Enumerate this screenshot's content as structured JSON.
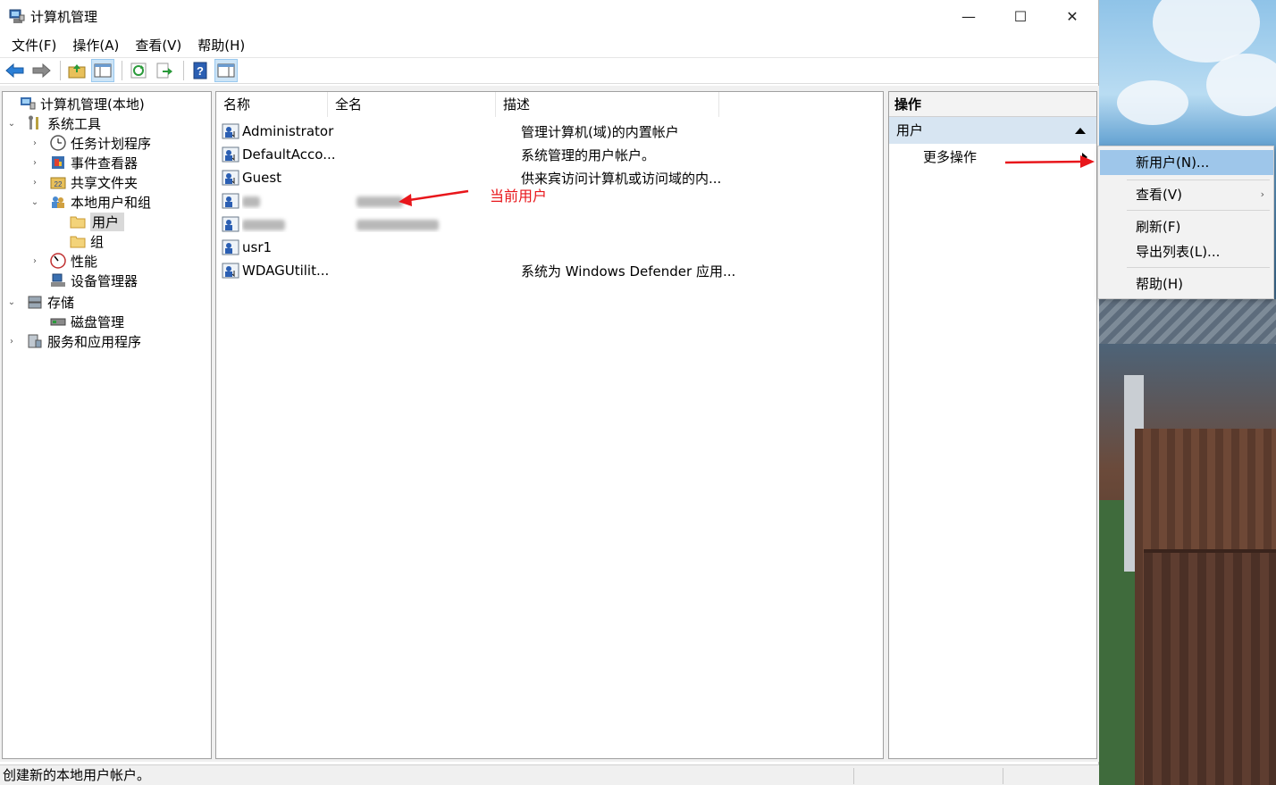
{
  "window": {
    "title": "计算机管理",
    "minimize": "—",
    "maximize": "☐",
    "close": "✕"
  },
  "menubar": {
    "items": [
      "文件(F)",
      "操作(A)",
      "查看(V)",
      "帮助(H)"
    ]
  },
  "tree": {
    "items": [
      {
        "label": "计算机管理(本地)",
        "expander": ""
      },
      {
        "label": "系统工具",
        "expander": "⌄"
      },
      {
        "label": "任务计划程序",
        "expander": "›"
      },
      {
        "label": "事件查看器",
        "expander": "›"
      },
      {
        "label": "共享文件夹",
        "expander": "›"
      },
      {
        "label": "本地用户和组",
        "expander": "⌄"
      },
      {
        "label": "用户",
        "expander": ""
      },
      {
        "label": "组",
        "expander": ""
      },
      {
        "label": "性能",
        "expander": "›"
      },
      {
        "label": "设备管理器",
        "expander": ""
      },
      {
        "label": "存储",
        "expander": "⌄"
      },
      {
        "label": "磁盘管理",
        "expander": ""
      },
      {
        "label": "服务和应用程序",
        "expander": "›"
      }
    ]
  },
  "list": {
    "columns": [
      "名称",
      "全名",
      "描述"
    ],
    "rows": [
      {
        "name": "Administrator",
        "fullname": "",
        "description": "管理计算机(域)的内置帐户"
      },
      {
        "name": "DefaultAcco...",
        "fullname": "",
        "description": "系统管理的用户帐户。"
      },
      {
        "name": "Guest",
        "fullname": "",
        "description": "供来宾访问计算机或访问域的内..."
      },
      {
        "name": "",
        "fullname": "",
        "description": ""
      },
      {
        "name": "",
        "fullname": "",
        "description": ""
      },
      {
        "name": "usr1",
        "fullname": "",
        "description": ""
      },
      {
        "name": "WDAGUtilit...",
        "fullname": "",
        "description": "系统为 Windows Defender 应用..."
      }
    ]
  },
  "annotation": {
    "text": "当前用户",
    "color": "#e8161b"
  },
  "actions": {
    "header": "操作",
    "section": "用户",
    "more": "更多操作"
  },
  "context_menu": {
    "items": [
      "新用户(N)...",
      "查看(V)",
      "刷新(F)",
      "导出列表(L)...",
      "帮助(H)"
    ],
    "submenu_indicator": "›"
  },
  "statusbar": {
    "text": "创建新的本地用户帐户。"
  },
  "colors": {
    "selection": "#d9d9d9",
    "section_bg": "#d7e5f2",
    "menu_highlight": "#9ec6ea",
    "arrow": "#e8161b"
  }
}
